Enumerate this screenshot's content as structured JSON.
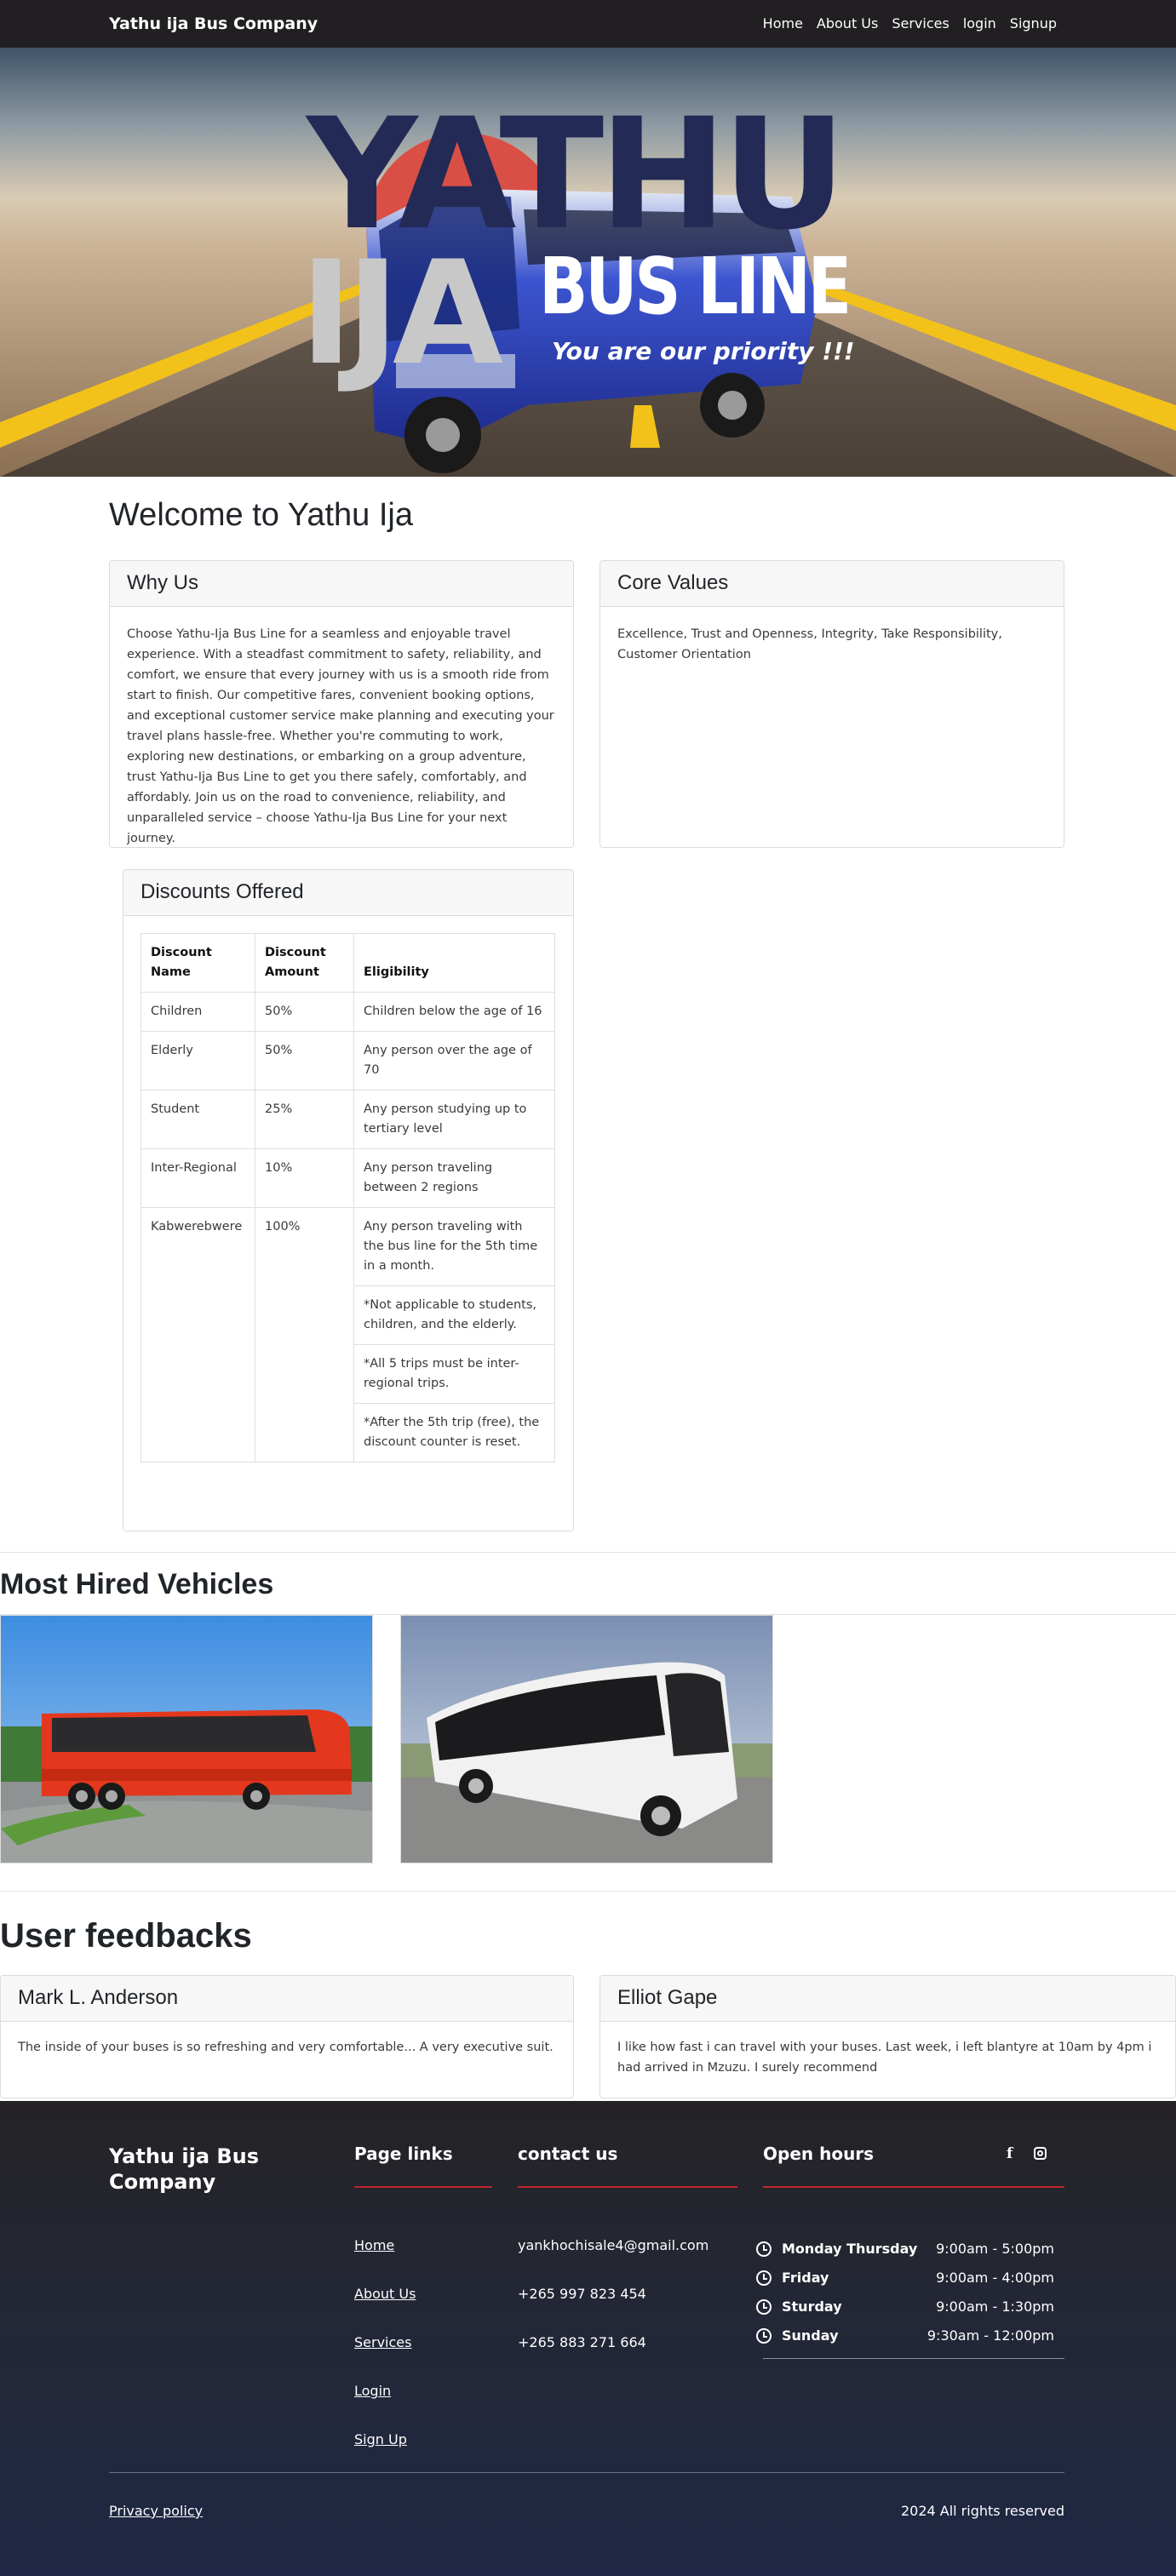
{
  "navbar": {
    "brand": "Yathu ija Bus Company",
    "links": [
      "Home",
      "About Us",
      "Services",
      "login",
      "Signup"
    ]
  },
  "hero": {
    "word1": "YATHU",
    "word2": "IJA",
    "word3": "BUS LINE",
    "tagline": "You are  our priority !!!"
  },
  "welcome": {
    "title": "Welcome to Yathu Ija"
  },
  "why_us": {
    "title": "Why Us",
    "body": "Choose Yathu-Ija Bus Line for a seamless and enjoyable travel experience. With a steadfast commitment to safety, reliability, and comfort, we ensure that every journey with us is a smooth ride from start to finish. Our competitive fares, convenient booking options, and exceptional customer service make planning and executing your travel plans hassle-free. Whether you're commuting to work, exploring new destinations, or embarking on a group adventure, trust Yathu-Ija Bus Line to get you there safely, comfortably, and affordably. Join us on the road to convenience, reliability, and unparalleled service – choose Yathu-Ija Bus Line for your next journey."
  },
  "core_values": {
    "title": "Core Values",
    "body": "Excellence, Trust and Openness, Integrity, Take Responsibility, Customer Orientation"
  },
  "discounts": {
    "title": "Discounts Offered",
    "headers": [
      "Discount Name",
      "Discount Amount",
      "Eligibility"
    ],
    "rows": [
      {
        "name": "Children",
        "amount": "50%",
        "eligibility": "Children below the age of 16"
      },
      {
        "name": "Elderly",
        "amount": "50%",
        "eligibility": "Any person over the age of 70"
      },
      {
        "name": "Student",
        "amount": "25%",
        "eligibility": "Any person studying up to tertiary level"
      },
      {
        "name": "Inter-Regional",
        "amount": "10%",
        "eligibility": "Any person traveling between 2 regions"
      }
    ],
    "kab": {
      "name": "Kabwerebwere",
      "amount": "100%",
      "eligibility": [
        "Any person traveling with the bus line for the 5th time in a month.",
        "*Not applicable to students, children, and the elderly.",
        "*All 5 trips must be inter-regional trips.",
        "*After the 5th trip (free), the discount counter is reset."
      ]
    }
  },
  "vehicles": {
    "title": "Most Hired Vehicles"
  },
  "feedback": {
    "title": "User feedbacks",
    "items": [
      {
        "name": "Mark L. Anderson",
        "text": "The inside of your buses is so refreshing and very comfortable... A very executive suit."
      },
      {
        "name": "Elliot Gape",
        "text": "I like how fast i can travel with your buses. Last week, i left blantyre at 10am by 4pm i had arrived in Mzuzu. I surely recommend"
      }
    ]
  },
  "footer": {
    "brand": "Yathu ija Bus Company",
    "page_links_title": "Page links",
    "page_links": [
      "Home",
      "About Us",
      "Services",
      "Login",
      "Sign Up"
    ],
    "contact_title": "contact us",
    "contacts": [
      "yankhochisale4@gmail.com",
      "+265 997 823 454",
      "+265 883 271 664"
    ],
    "hours_title": "Open hours",
    "hours": [
      {
        "day": "Monday Thursday",
        "time": "9:00am - 5:00pm"
      },
      {
        "day": "Friday",
        "time": "9:00am - 4:00pm"
      },
      {
        "day": "Sturday",
        "time": "9:00am - 1:30pm"
      },
      {
        "day": "Sunday",
        "time": "9:30am - 12:00pm"
      }
    ],
    "privacy": "Privacy policy",
    "copyright": "2024 All rights reserved",
    "accent": "#c0242b"
  }
}
